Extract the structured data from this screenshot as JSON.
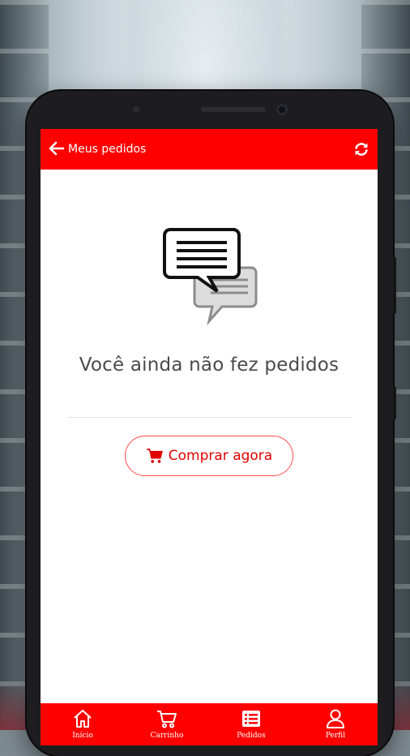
{
  "header": {
    "title": "Meus pedidos",
    "back_icon": "arrow-left-icon",
    "refresh_icon": "refresh-icon"
  },
  "empty_state": {
    "icon": "chat-bubbles-icon",
    "message": "Você ainda não fez pedidos"
  },
  "buy_button": {
    "label": "Comprar agora",
    "icon": "shopping-cart-icon"
  },
  "bottom_nav": {
    "items": [
      {
        "label": "Início",
        "icon": "home-icon"
      },
      {
        "label": "Carrinho",
        "icon": "cart-icon"
      },
      {
        "label": "Pedidos",
        "icon": "orders-list-icon"
      },
      {
        "label": "Perfil",
        "icon": "user-icon"
      }
    ]
  },
  "colors": {
    "primary": "#ff0000",
    "button_text": "#e10000",
    "text": "#4a4a4a"
  }
}
